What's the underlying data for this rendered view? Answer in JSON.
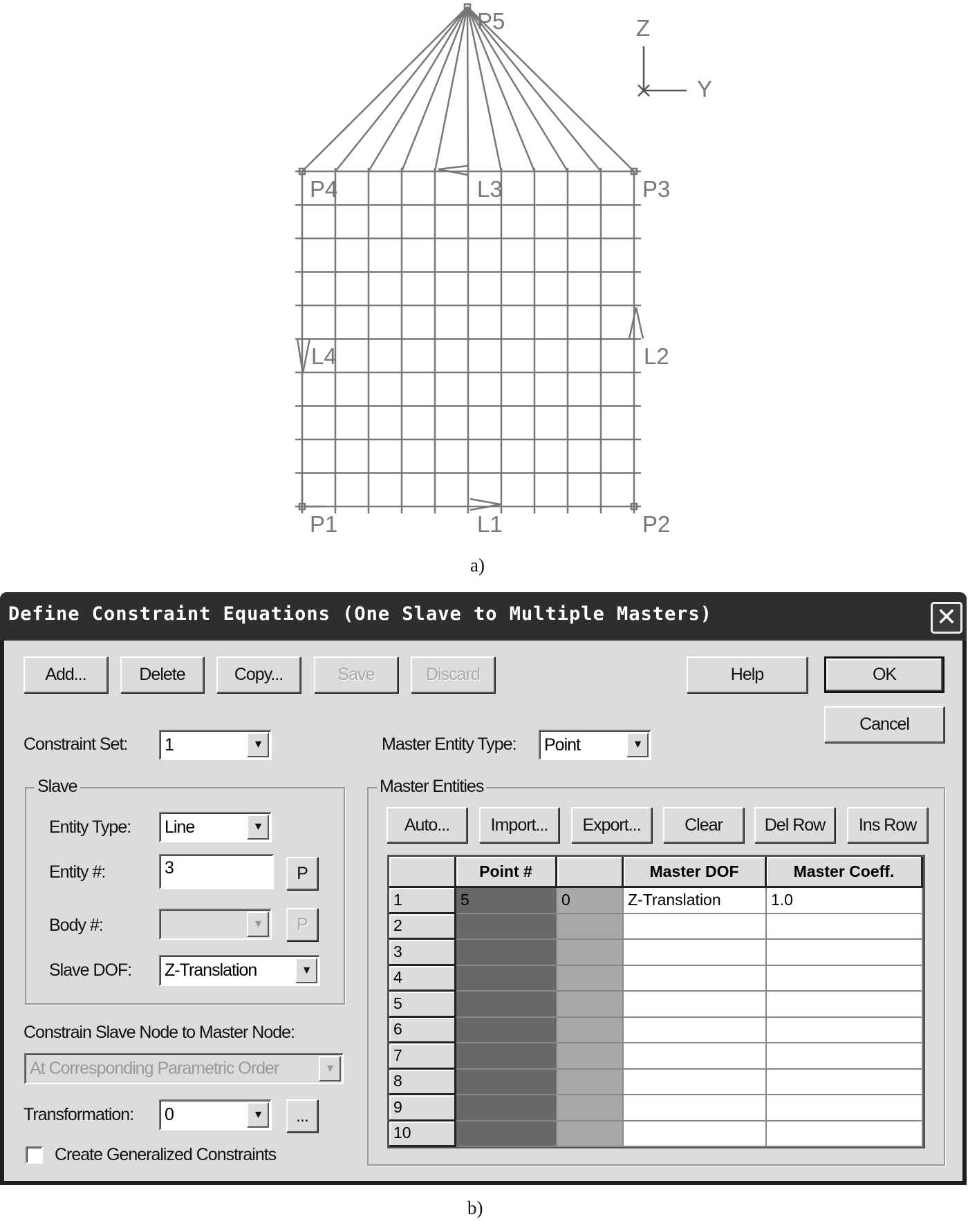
{
  "figure": {
    "caption_a": "a)",
    "caption_b": "b)",
    "points": {
      "p1": "P1",
      "p2": "P2",
      "p3": "P3",
      "p4": "P4",
      "p5": "P5"
    },
    "lines": {
      "l1": "L1",
      "l2": "L2",
      "l3": "L3",
      "l4": "L4"
    },
    "axes": {
      "z": "Z",
      "y": "Y"
    }
  },
  "dialog": {
    "title": "Define Constraint Equations (One Slave to Multiple Masters)",
    "close_icon": "close-icon",
    "buttons": {
      "add": "Add...",
      "delete": "Delete",
      "copy": "Copy...",
      "save": "Save",
      "discard": "Discard",
      "help": "Help",
      "ok": "OK",
      "cancel": "Cancel"
    },
    "constraint_set": {
      "label": "Constraint Set:",
      "value": "1"
    },
    "master_entity_type": {
      "label": "Master Entity Type:",
      "value": "Point"
    },
    "slave": {
      "group_label": "Slave",
      "entity_type": {
        "label": "Entity Type:",
        "value": "Line"
      },
      "entity_num": {
        "label": "Entity #:",
        "value": "3",
        "pick": "P"
      },
      "body_num": {
        "label": "Body #:",
        "value": "",
        "pick": "P"
      },
      "slave_dof": {
        "label": "Slave DOF:",
        "value": "Z-Translation"
      }
    },
    "constrain_node": {
      "label": "Constrain Slave Node to Master Node:",
      "value": "At Corresponding Parametric Order"
    },
    "transformation": {
      "label": "Transformation:",
      "value": "0",
      "more": "..."
    },
    "generalized": {
      "label": "Create Generalized Constraints",
      "checked": false
    },
    "master": {
      "group_label": "Master Entities",
      "buttons": {
        "auto": "Auto...",
        "import": "Import...",
        "export": "Export...",
        "clear": "Clear",
        "del_row": "Del Row",
        "ins_row": "Ins Row"
      },
      "columns": [
        "",
        "Point #",
        "",
        "Master DOF",
        "Master Coeff."
      ],
      "rows": [
        [
          "1",
          "5",
          "0",
          "Z-Translation",
          "1.0"
        ],
        [
          "2",
          "",
          "",
          "",
          ""
        ],
        [
          "3",
          "",
          "",
          "",
          ""
        ],
        [
          "4",
          "",
          "",
          "",
          ""
        ],
        [
          "5",
          "",
          "",
          "",
          ""
        ],
        [
          "6",
          "",
          "",
          "",
          ""
        ],
        [
          "7",
          "",
          "",
          "",
          ""
        ],
        [
          "8",
          "",
          "",
          "",
          ""
        ],
        [
          "9",
          "",
          "",
          "",
          ""
        ],
        [
          "10",
          "",
          "",
          "",
          ""
        ]
      ]
    }
  }
}
